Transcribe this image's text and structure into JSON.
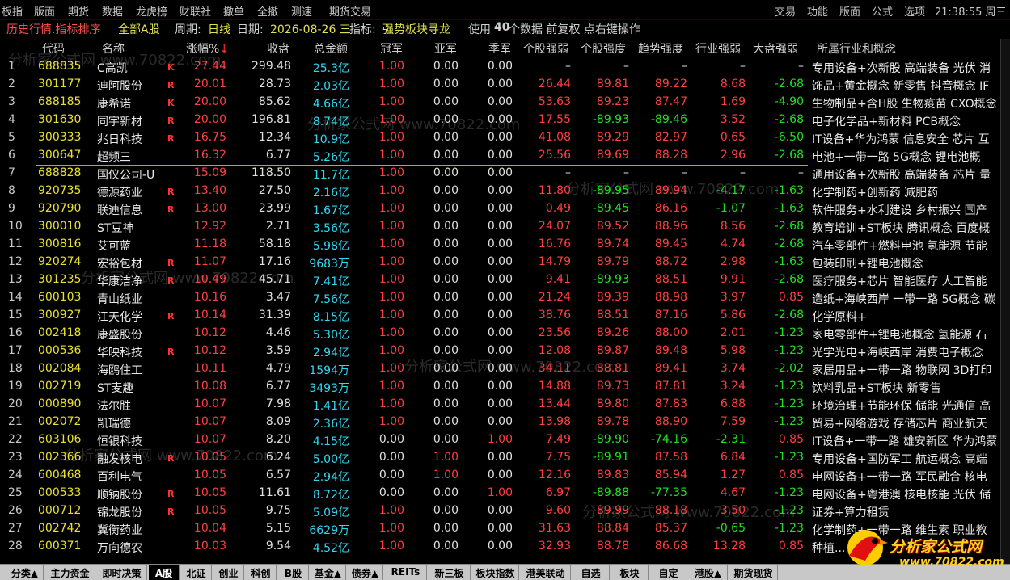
{
  "menubar": {
    "left": [
      "板指",
      "版面",
      "期货",
      "数据",
      "龙虎榜",
      "财联社",
      "撤单",
      "全撤",
      "测速",
      "期货交易"
    ],
    "right": [
      "交易",
      "功能",
      "版面",
      "公式",
      "选项"
    ],
    "clock": "21:38:55 周三"
  },
  "infobar": {
    "title": "历史行情.指标排序",
    "market": "全部A股",
    "period_label": "周期:",
    "period": "日线",
    "date_label": "日期:",
    "date": "2026-08-26 三",
    "indicator_label": "指标:",
    "indicator": "强势板块寻龙",
    "use_prefix": "使用",
    "count": "40",
    "use_suffix": "个数据 前复权 点右键操作"
  },
  "columns": {
    "code": "代码",
    "name": "名称",
    "change": "涨幅%",
    "close": "收盘",
    "amount": "总金额",
    "champion": "冠军",
    "runner_up": "亚军",
    "third": "季军",
    "stock_weak": "个股强弱",
    "stock_strength": "个股强度",
    "trend_strength": "趋势强度",
    "industry_strength": "行业强弱",
    "market_strength": "大盘强弱",
    "industry": "所属行业和概念"
  },
  "rows": [
    {
      "num": "1",
      "code": "688835",
      "name": "C高凯",
      "flag": "K",
      "chg": "27.44",
      "close": "299.48",
      "amt": "25.3",
      "unit": "亿",
      "g1": "1.00",
      "g2": "0.00",
      "g3": "0.00",
      "s1": "–",
      "s2": "–",
      "s3": "–",
      "s4": "–",
      "s5": "–",
      "ind": "专用设备+次新股 高端装备 光伏 消"
    },
    {
      "num": "2",
      "code": "301177",
      "name": "迪阿股份",
      "flag": "R",
      "chg": "20.01",
      "close": "28.73",
      "amt": "2.03",
      "unit": "亿",
      "g1": "1.00",
      "g2": "0.00",
      "g3": "0.00",
      "s1": "26.44",
      "s2": "89.81",
      "s3": "89.22",
      "s4": "8.68",
      "s5": "-2.68",
      "ind": "饰品+黄金概念 新零售 抖音概念 IF"
    },
    {
      "num": "3",
      "code": "688185",
      "name": "康希诺",
      "flag": "K",
      "chg": "20.00",
      "close": "85.62",
      "amt": "4.66",
      "unit": "亿",
      "g1": "1.00",
      "g2": "0.00",
      "g3": "0.00",
      "s1": "53.63",
      "s2": "89.23",
      "s3": "87.47",
      "s4": "1.69",
      "s5": "-4.90",
      "ind": "生物制品+含H股 生物疫苗 CXO概念"
    },
    {
      "num": "4",
      "code": "301630",
      "name": "同宇新材",
      "flag": "R",
      "chg": "20.00",
      "close": "196.81",
      "amt": "8.74",
      "unit": "亿",
      "g1": "1.00",
      "g2": "0.00",
      "g3": "0.00",
      "s1": "17.55",
      "s2": "-89.93",
      "s3": "-89.46",
      "s4": "3.52",
      "s5": "-2.68",
      "ind": "电子化学品+新材料 PCB概念"
    },
    {
      "num": "5",
      "code": "300333",
      "name": "兆日科技",
      "flag": "R",
      "chg": "16.75",
      "close": "12.34",
      "amt": "10.9",
      "unit": "亿",
      "g1": "1.00",
      "g2": "0.00",
      "g3": "0.00",
      "s1": "41.08",
      "s2": "89.29",
      "s3": "82.97",
      "s4": "0.65",
      "s5": "-6.50",
      "ind": "IT设备+华为鸿蒙 信息安全 芯片 互"
    },
    {
      "num": "6",
      "code": "300647",
      "name": "超频三",
      "flag": "",
      "chg": "16.32",
      "close": "6.77",
      "amt": "5.26",
      "unit": "亿",
      "g1": "1.00",
      "g2": "0.00",
      "g3": "0.00",
      "s1": "25.56",
      "s2": "89.69",
      "s3": "88.28",
      "s4": "2.96",
      "s5": "-2.68",
      "ind": "电池+一带一路 5G概念 锂电池概"
    },
    {
      "num": "7",
      "code": "688828",
      "name": "国仪公司-U",
      "flag": "",
      "chg": "15.09",
      "close": "118.50",
      "amt": "11.7",
      "unit": "亿",
      "g1": "1.00",
      "g2": "0.00",
      "g3": "0.00",
      "s1": "–",
      "s2": "–",
      "s3": "–",
      "s4": "–",
      "s5": "–",
      "ind": "通用设备+次新股 高端装备 芯片 量"
    },
    {
      "num": "8",
      "code": "920735",
      "name": "德源药业",
      "flag": "R",
      "chg": "13.40",
      "close": "27.50",
      "amt": "2.16",
      "unit": "亿",
      "g1": "1.00",
      "g2": "0.00",
      "g3": "0.00",
      "s1": "11.80",
      "s2": "-89.95",
      "s3": "89.94",
      "s4": "-4.17",
      "s5": "-1.63",
      "ind": "化学制药+创新药 减肥药"
    },
    {
      "num": "9",
      "code": "920790",
      "name": "联迪信息",
      "flag": "R",
      "chg": "13.00",
      "close": "23.99",
      "amt": "1.67",
      "unit": "亿",
      "g1": "1.00",
      "g2": "0.00",
      "g3": "0.00",
      "s1": "0.49",
      "s2": "-89.45",
      "s3": "86.16",
      "s4": "-1.07",
      "s5": "-1.63",
      "ind": "软件服务+水利建设 乡村振兴 国产"
    },
    {
      "num": "10",
      "code": "300010",
      "name": "ST豆神",
      "flag": "",
      "chg": "12.92",
      "close": "2.71",
      "amt": "3.56",
      "unit": "亿",
      "g1": "1.00",
      "g2": "0.00",
      "g3": "0.00",
      "s1": "24.07",
      "s2": "89.52",
      "s3": "88.96",
      "s4": "8.56",
      "s5": "-2.68",
      "ind": "教育培训+ST板块 腾讯概念 百度概"
    },
    {
      "num": "11",
      "code": "300816",
      "name": "艾可蓝",
      "flag": "",
      "chg": "11.18",
      "close": "58.18",
      "amt": "5.98",
      "unit": "亿",
      "g1": "1.00",
      "g2": "0.00",
      "g3": "0.00",
      "s1": "16.76",
      "s2": "89.74",
      "s3": "89.45",
      "s4": "4.74",
      "s5": "-2.68",
      "ind": "汽车零部件+燃料电池 氢能源 节能"
    },
    {
      "num": "12",
      "code": "920274",
      "name": "宏裕包材",
      "flag": "R",
      "chg": "11.07",
      "close": "17.16",
      "amt": "9683",
      "unit": "万",
      "g1": "1.00",
      "g2": "0.00",
      "g3": "0.00",
      "s1": "14.79",
      "s2": "89.79",
      "s3": "88.72",
      "s4": "2.98",
      "s5": "-1.63",
      "ind": "包装印刷+锂电池概念"
    },
    {
      "num": "13",
      "code": "301235",
      "name": "华康洁净",
      "flag": "R",
      "chg": "10.49",
      "close": "45.71",
      "amt": "7.41",
      "unit": "亿",
      "g1": "1.00",
      "g2": "0.00",
      "g3": "0.00",
      "s1": "9.41",
      "s2": "-89.93",
      "s3": "88.51",
      "s4": "9.91",
      "s5": "-2.68",
      "ind": "医疗服务+芯片 智能医疗 人工智能"
    },
    {
      "num": "14",
      "code": "600103",
      "name": "青山纸业",
      "flag": "",
      "chg": "10.16",
      "close": "3.47",
      "amt": "7.56",
      "unit": "亿",
      "g1": "1.00",
      "g2": "0.00",
      "g3": "0.00",
      "s1": "21.24",
      "s2": "89.39",
      "s3": "88.98",
      "s4": "3.97",
      "s5": "0.85",
      "ind": "造纸+海峡西岸 一带一路 5G概念 碳"
    },
    {
      "num": "15",
      "code": "300927",
      "name": "江天化学",
      "flag": "R",
      "chg": "10.14",
      "close": "31.39",
      "amt": "8.15",
      "unit": "亿",
      "g1": "1.00",
      "g2": "0.00",
      "g3": "0.00",
      "s1": "38.76",
      "s2": "88.51",
      "s3": "87.16",
      "s4": "5.86",
      "s5": "-2.68",
      "ind": "化学原料+"
    },
    {
      "num": "16",
      "code": "002418",
      "name": "康盛股份",
      "flag": "",
      "chg": "10.12",
      "close": "4.46",
      "amt": "5.30",
      "unit": "亿",
      "g1": "1.00",
      "g2": "0.00",
      "g3": "0.00",
      "s1": "23.56",
      "s2": "89.26",
      "s3": "88.00",
      "s4": "2.01",
      "s5": "-1.23",
      "ind": "家电零部件+锂电池概念 氢能源 石"
    },
    {
      "num": "17",
      "code": "000536",
      "name": "华映科技",
      "flag": "R",
      "chg": "10.12",
      "close": "3.59",
      "amt": "2.94",
      "unit": "亿",
      "g1": "1.00",
      "g2": "0.00",
      "g3": "0.00",
      "s1": "12.08",
      "s2": "89.87",
      "s3": "89.48",
      "s4": "5.98",
      "s5": "-1.23",
      "ind": "光学光电+海峡西岸 消费电子概念"
    },
    {
      "num": "18",
      "code": "002084",
      "name": "海鸥住工",
      "flag": "",
      "chg": "10.11",
      "close": "4.79",
      "amt": "1594",
      "unit": "万",
      "g1": "1.00",
      "g2": "0.00",
      "g3": "0.00",
      "s1": "34.11",
      "s2": "88.81",
      "s3": "89.41",
      "s4": "3.74",
      "s5": "-2.02",
      "ind": "家居用品+一带一路 物联网 3D打印"
    },
    {
      "num": "19",
      "code": "002719",
      "name": "ST麦趣",
      "flag": "",
      "chg": "10.08",
      "close": "6.77",
      "amt": "3493",
      "unit": "万",
      "g1": "1.00",
      "g2": "0.00",
      "g3": "0.00",
      "s1": "14.88",
      "s2": "89.73",
      "s3": "87.81",
      "s4": "3.24",
      "s5": "-1.23",
      "ind": "饮料乳品+ST板块 新零售"
    },
    {
      "num": "20",
      "code": "000890",
      "name": "法尔胜",
      "flag": "",
      "chg": "10.07",
      "close": "7.98",
      "amt": "1.41",
      "unit": "亿",
      "g1": "1.00",
      "g2": "0.00",
      "g3": "0.00",
      "s1": "13.44",
      "s2": "89.80",
      "s3": "87.83",
      "s4": "6.88",
      "s5": "-1.23",
      "ind": "环境治理+节能环保 储能 光通信 高"
    },
    {
      "num": "21",
      "code": "002072",
      "name": "凯瑞德",
      "flag": "",
      "chg": "10.07",
      "close": "8.09",
      "amt": "2.36",
      "unit": "亿",
      "g1": "1.00",
      "g2": "0.00",
      "g3": "0.00",
      "s1": "13.98",
      "s2": "89.78",
      "s3": "88.90",
      "s4": "7.59",
      "s5": "-1.23",
      "ind": "贸易+网络游戏 存储芯片 商业航天"
    },
    {
      "num": "22",
      "code": "603106",
      "name": "恒银科技",
      "flag": "",
      "chg": "10.07",
      "close": "8.20",
      "amt": "4.15",
      "unit": "亿",
      "g1": "0.00",
      "g2": "0.00",
      "g3": "1.00",
      "s1": "7.49",
      "s2": "-89.90",
      "s3": "-74.16",
      "s4": "-2.31",
      "s5": "0.85",
      "ind": "IT设备+一带一路 雄安新区 华为鸿蒙"
    },
    {
      "num": "23",
      "code": "002366",
      "name": "融发核电",
      "flag": "R",
      "chg": "10.05",
      "close": "6.24",
      "amt": "5.00",
      "unit": "亿",
      "g1": "0.00",
      "g2": "1.00",
      "g3": "0.00",
      "s1": "7.75",
      "s2": "-89.91",
      "s3": "87.58",
      "s4": "6.84",
      "s5": "-1.23",
      "ind": "专用设备+国防军工 航运概念 高端"
    },
    {
      "num": "24",
      "code": "600468",
      "name": "百利电气",
      "flag": "",
      "chg": "10.05",
      "close": "6.57",
      "amt": "2.94",
      "unit": "亿",
      "g1": "0.00",
      "g2": "1.00",
      "g3": "0.00",
      "s1": "12.16",
      "s2": "89.83",
      "s3": "85.94",
      "s4": "1.27",
      "s5": "0.85",
      "ind": "电网设备+一带一路 军民融合 核电"
    },
    {
      "num": "25",
      "code": "000533",
      "name": "顺钠股份",
      "flag": "R",
      "chg": "10.05",
      "close": "11.61",
      "amt": "8.72",
      "unit": "亿",
      "g1": "0.00",
      "g2": "0.00",
      "g3": "1.00",
      "s1": "6.97",
      "s2": "-89.88",
      "s3": "-77.35",
      "s4": "4.67",
      "s5": "-1.23",
      "ind": "电网设备+粤港澳 核电核能 光伏 储"
    },
    {
      "num": "26",
      "code": "000712",
      "name": "锦龙股份",
      "flag": "R",
      "chg": "10.05",
      "close": "9.75",
      "amt": "5.09",
      "unit": "亿",
      "g1": "1.00",
      "g2": "0.00",
      "g3": "0.00",
      "s1": "9.60",
      "s2": "89.99",
      "s3": "88.18",
      "s4": "3.50",
      "s5": "-1.23",
      "ind": "证券+算力租赁"
    },
    {
      "num": "27",
      "code": "002742",
      "name": "冀衡药业",
      "flag": "",
      "chg": "10.04",
      "close": "5.15",
      "amt": "6629",
      "unit": "万",
      "g1": "1.00",
      "g2": "0.00",
      "g3": "0.00",
      "s1": "31.63",
      "s2": "88.84",
      "s3": "85.37",
      "s4": "-0.65",
      "s5": "-1.23",
      "ind": "化学制药+一带一路 维生素 职业教"
    },
    {
      "num": "28",
      "code": "600371",
      "name": "万向德农",
      "flag": "",
      "chg": "10.03",
      "close": "9.54",
      "amt": "4.52",
      "unit": "亿",
      "g1": "1.00",
      "g2": "0.00",
      "g3": "0.00",
      "s1": "32.93",
      "s2": "88.78",
      "s3": "86.68",
      "s4": "13.28",
      "s5": "0.85",
      "ind": "种植..."
    }
  ],
  "tabs": [
    "分类▲",
    "主力资金",
    "即时决策",
    "A股",
    "北证",
    "创业",
    "科创",
    "B股",
    "基金▲",
    "债券▲",
    "REITs",
    "新三板",
    "板块指数",
    "港美联动",
    "自选",
    "板块",
    "自定",
    "港股▲",
    "期货现货"
  ],
  "active_tab": "A股",
  "logo": {
    "line1": "分析家公式网",
    "line2": "www.70822.com"
  },
  "colors": {
    "up": "#ff4040",
    "down": "#20e020",
    "code": "#e8e030",
    "amount": "#30d8f0",
    "background": "#000000"
  }
}
